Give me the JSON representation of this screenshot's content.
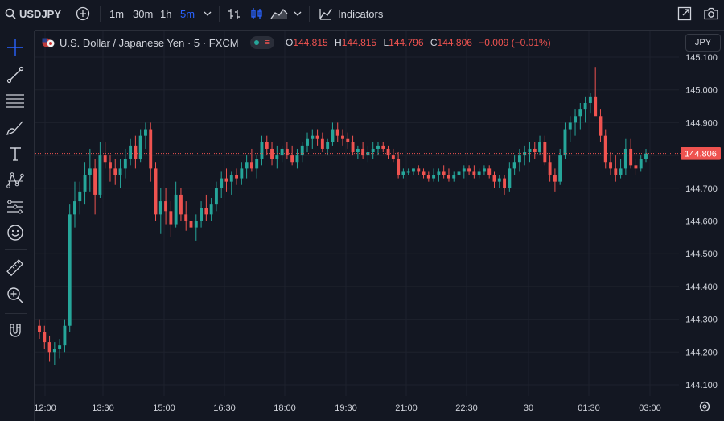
{
  "toolbar": {
    "symbol": "USDJPY",
    "timeframes": [
      "1m",
      "30m",
      "1h",
      "5m"
    ],
    "active_timeframe": "5m",
    "indicators_label": "Indicators",
    "icons": [
      "search-icon",
      "add-symbol-icon",
      "chevron-down-icon",
      "bar-style-icon",
      "candle-style-icon",
      "area-style-icon",
      "chevron-down-icon",
      "indicators-icon",
      "fullscreen-icon",
      "camera-icon"
    ]
  },
  "sidebar": {
    "tools": [
      "crosshair-icon",
      "trendline-icon",
      "fib-retracement-icon",
      "brush-icon",
      "text-icon",
      "pattern-icon",
      "forecast-icon",
      "emoji-icon",
      "ruler-icon",
      "zoom-in-icon",
      "magnet-icon"
    ]
  },
  "legend": {
    "title": "U.S. Dollar / Japanese Yen · 5 · FXCM",
    "open_label": "O",
    "open": "144.815",
    "high_label": "H",
    "high": "144.815",
    "low_label": "L",
    "low": "144.796",
    "close_label": "C",
    "close": "144.806",
    "change": "−0.009 (−0.01%)"
  },
  "currency_button": "JPY",
  "colors": {
    "background": "#131722",
    "up": "#26a69a",
    "down": "#ef5350",
    "accent": "#2962ff",
    "grid": "#1e222d",
    "text": "#d1d4dc"
  },
  "chart_data": {
    "type": "candlestick",
    "symbol": "USDJPY",
    "interval": "5m",
    "ylim": [
      144.06,
      145.14
    ],
    "grid": true,
    "y_ticks": [
      "145.100",
      "145.000",
      "144.900",
      "144.800",
      "144.700",
      "144.600",
      "144.500",
      "144.400",
      "144.300",
      "144.200",
      "144.100"
    ],
    "x_ticks": [
      "12:00",
      "13:30",
      "15:00",
      "16:30",
      "18:00",
      "19:30",
      "21:00",
      "22:30",
      "30",
      "01:30",
      "03:00"
    ],
    "last_price": "144.806",
    "candles": [
      [
        144.28,
        144.3,
        144.24,
        144.26
      ],
      [
        144.26,
        144.28,
        144.21,
        144.23
      ],
      [
        144.23,
        144.25,
        144.17,
        144.2
      ],
      [
        144.2,
        144.23,
        144.16,
        144.21
      ],
      [
        144.21,
        144.24,
        144.18,
        144.22
      ],
      [
        144.22,
        144.3,
        144.2,
        144.28
      ],
      [
        144.28,
        144.65,
        144.26,
        144.62
      ],
      [
        144.62,
        144.72,
        144.58,
        144.66
      ],
      [
        144.66,
        144.72,
        144.62,
        144.69
      ],
      [
        144.69,
        144.78,
        144.65,
        144.74
      ],
      [
        144.74,
        144.82,
        144.69,
        144.76
      ],
      [
        144.76,
        144.79,
        144.62,
        144.68
      ],
      [
        144.68,
        144.84,
        144.67,
        144.8
      ],
      [
        144.8,
        144.84,
        144.76,
        144.78
      ],
      [
        144.78,
        144.8,
        144.72,
        144.76
      ],
      [
        144.76,
        144.79,
        144.71,
        144.74
      ],
      [
        144.74,
        144.79,
        144.7,
        144.76
      ],
      [
        144.76,
        144.82,
        144.73,
        144.79
      ],
      [
        144.79,
        144.85,
        144.77,
        144.83
      ],
      [
        144.83,
        144.86,
        144.76,
        144.79
      ],
      [
        144.79,
        144.88,
        144.78,
        144.86
      ],
      [
        144.86,
        144.9,
        144.82,
        144.88
      ],
      [
        144.88,
        144.9,
        144.72,
        144.76
      ],
      [
        144.76,
        144.78,
        144.6,
        144.62
      ],
      [
        144.62,
        144.7,
        144.56,
        144.66
      ],
      [
        144.66,
        144.7,
        144.59,
        144.63
      ],
      [
        144.63,
        144.66,
        144.55,
        144.59
      ],
      [
        144.59,
        144.72,
        144.58,
        144.68
      ],
      [
        144.68,
        144.7,
        144.6,
        144.62
      ],
      [
        144.62,
        144.66,
        144.57,
        144.6
      ],
      [
        144.6,
        144.64,
        144.55,
        144.58
      ],
      [
        144.58,
        144.62,
        144.54,
        144.6
      ],
      [
        144.6,
        144.66,
        144.58,
        144.64
      ],
      [
        144.64,
        144.68,
        144.6,
        144.62
      ],
      [
        144.62,
        144.67,
        144.6,
        144.65
      ],
      [
        144.65,
        144.72,
        144.63,
        144.7
      ],
      [
        144.7,
        144.75,
        144.67,
        144.73
      ],
      [
        144.73,
        144.76,
        144.69,
        144.72
      ],
      [
        144.72,
        144.75,
        144.68,
        144.74
      ],
      [
        144.74,
        144.76,
        144.71,
        144.73
      ],
      [
        144.73,
        144.78,
        144.71,
        144.76
      ],
      [
        144.76,
        144.8,
        144.73,
        144.78
      ],
      [
        144.78,
        144.82,
        144.75,
        144.76
      ],
      [
        144.76,
        144.8,
        144.73,
        144.79
      ],
      [
        144.79,
        144.86,
        144.77,
        144.84
      ],
      [
        144.84,
        144.86,
        144.8,
        144.82
      ],
      [
        144.82,
        144.84,
        144.77,
        144.79
      ],
      [
        144.79,
        144.83,
        144.76,
        144.8
      ],
      [
        144.8,
        144.83,
        144.78,
        144.82
      ],
      [
        144.82,
        144.84,
        144.79,
        144.8
      ],
      [
        144.8,
        144.83,
        144.77,
        144.78
      ],
      [
        144.78,
        144.82,
        144.76,
        144.8
      ],
      [
        144.8,
        144.84,
        144.78,
        144.83
      ],
      [
        144.83,
        144.87,
        144.81,
        144.85
      ],
      [
        144.85,
        144.88,
        144.82,
        144.86
      ],
      [
        144.86,
        144.88,
        144.83,
        144.85
      ],
      [
        144.85,
        144.87,
        144.81,
        144.82
      ],
      [
        144.82,
        144.85,
        144.8,
        144.84
      ],
      [
        144.84,
        144.9,
        144.83,
        144.88
      ],
      [
        144.88,
        144.9,
        144.84,
        144.86
      ],
      [
        144.86,
        144.88,
        144.83,
        144.85
      ],
      [
        144.85,
        144.87,
        144.82,
        144.84
      ],
      [
        144.84,
        144.86,
        144.8,
        144.81
      ],
      [
        144.81,
        144.83,
        144.79,
        144.82
      ],
      [
        144.82,
        144.84,
        144.79,
        144.8
      ],
      [
        144.8,
        144.83,
        144.78,
        144.81
      ],
      [
        144.81,
        144.84,
        144.79,
        144.82
      ],
      [
        144.82,
        144.84,
        144.8,
        144.83
      ],
      [
        144.83,
        144.84,
        144.81,
        144.82
      ],
      [
        144.82,
        144.83,
        144.79,
        144.8
      ],
      [
        144.8,
        144.82,
        144.78,
        144.79
      ],
      [
        144.79,
        144.81,
        144.73,
        144.74
      ],
      [
        144.74,
        144.76,
        144.73,
        144.75
      ],
      [
        144.75,
        144.76,
        144.74,
        144.75
      ],
      [
        144.75,
        144.76,
        144.74,
        144.76
      ],
      [
        144.76,
        144.77,
        144.74,
        144.75
      ],
      [
        144.75,
        144.76,
        144.73,
        144.74
      ],
      [
        144.74,
        144.75,
        144.72,
        144.73
      ],
      [
        144.73,
        144.76,
        144.72,
        144.74
      ],
      [
        144.74,
        144.76,
        144.72,
        144.75
      ],
      [
        144.75,
        144.77,
        144.73,
        144.74
      ],
      [
        144.74,
        144.76,
        144.72,
        144.73
      ],
      [
        144.73,
        144.75,
        144.72,
        144.74
      ],
      [
        144.74,
        144.76,
        144.73,
        144.75
      ],
      [
        144.75,
        144.77,
        144.73,
        144.76
      ],
      [
        144.76,
        144.77,
        144.74,
        144.75
      ],
      [
        144.75,
        144.77,
        144.73,
        144.74
      ],
      [
        144.74,
        144.76,
        144.73,
        144.75
      ],
      [
        144.75,
        144.77,
        144.74,
        144.76
      ],
      [
        144.76,
        144.77,
        144.73,
        144.74
      ],
      [
        144.74,
        144.75,
        144.7,
        144.72
      ],
      [
        144.72,
        144.74,
        144.7,
        144.73
      ],
      [
        144.73,
        144.74,
        144.68,
        144.7
      ],
      [
        144.7,
        144.78,
        144.69,
        144.76
      ],
      [
        144.76,
        144.8,
        144.74,
        144.78
      ],
      [
        144.78,
        144.82,
        144.75,
        144.8
      ],
      [
        144.8,
        144.83,
        144.77,
        144.81
      ],
      [
        144.81,
        144.84,
        144.78,
        144.82
      ],
      [
        144.82,
        144.84,
        144.79,
        144.81
      ],
      [
        144.81,
        144.86,
        144.8,
        144.84
      ],
      [
        144.84,
        144.86,
        144.77,
        144.78
      ],
      [
        144.78,
        144.8,
        144.72,
        144.74
      ],
      [
        144.74,
        144.76,
        144.69,
        144.72
      ],
      [
        144.72,
        144.82,
        144.71,
        144.8
      ],
      [
        144.8,
        144.9,
        144.79,
        144.88
      ],
      [
        144.88,
        144.92,
        144.84,
        144.9
      ],
      [
        144.9,
        144.94,
        144.86,
        144.92
      ],
      [
        144.92,
        144.96,
        144.88,
        144.94
      ],
      [
        144.94,
        144.98,
        144.9,
        144.96
      ],
      [
        144.96,
        144.99,
        144.93,
        144.98
      ],
      [
        144.98,
        145.07,
        144.96,
        144.92
      ],
      [
        144.92,
        144.94,
        144.84,
        144.86
      ],
      [
        144.86,
        144.88,
        144.76,
        144.78
      ],
      [
        144.78,
        144.81,
        144.74,
        144.76
      ],
      [
        144.76,
        144.8,
        144.72,
        144.74
      ],
      [
        144.74,
        144.79,
        144.73,
        144.76
      ],
      [
        144.76,
        144.85,
        144.74,
        144.82
      ],
      [
        144.82,
        144.85,
        144.76,
        144.77
      ],
      [
        144.77,
        144.79,
        144.74,
        144.76
      ],
      [
        144.76,
        144.8,
        144.75,
        144.79
      ],
      [
        144.79,
        144.82,
        144.78,
        144.806
      ]
    ]
  }
}
